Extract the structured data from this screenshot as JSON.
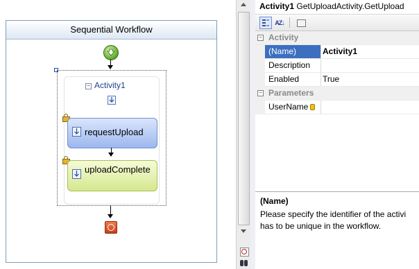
{
  "designer": {
    "workflow_title": "Sequential Workflow",
    "sequence_title": "Activity1",
    "sequence_collapse_glyph": "−",
    "activities": [
      {
        "label": "requestUpload",
        "locked": true,
        "color": "#9cb7ef"
      },
      {
        "label": "uploadComplete",
        "locked": true,
        "color": "#d5e88e"
      }
    ],
    "start_icon": "start-arrow-icon",
    "end_icon": "stop-icon"
  },
  "properties": {
    "header_name": "Activity1",
    "header_type": "GetUploadActivity.GetUpload",
    "toolbar": {
      "categorized_icon": "categorized-icon",
      "alphabetical_label": "AZ↓",
      "property_pages_icon": "property-pages-icon"
    },
    "categories": [
      {
        "name": "Activity",
        "collapse_glyph": "−",
        "rows": [
          {
            "name": "(Name)",
            "value": "Activity1"
          },
          {
            "name": "Description",
            "value": ""
          },
          {
            "name": "Enabled",
            "value": "True"
          }
        ]
      },
      {
        "name": "Parameters",
        "collapse_glyph": "−",
        "rows": [
          {
            "name": "UserName",
            "value": ""
          }
        ]
      }
    ],
    "description": {
      "title": "(Name)",
      "line1": "Please specify the identifier of the activi",
      "line2": "has to be unique in the workflow."
    }
  },
  "colors": {
    "selection": "#3d6fbf",
    "border": "#7f9db9",
    "end_node": "#c8401a",
    "start_node": "#5aa52a"
  }
}
